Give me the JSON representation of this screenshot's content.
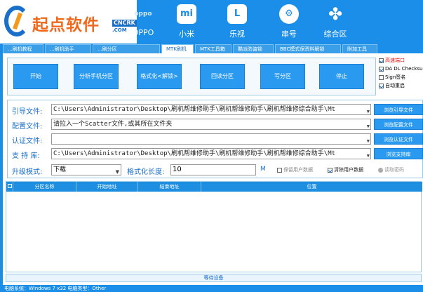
{
  "logo": {
    "name": "起点软件",
    "badge_top": "CNCRK",
    "badge_bottom": ".COM"
  },
  "nav": [
    {
      "label": "OPPO",
      "icon": "oppo-icon",
      "glyph": "oppo"
    },
    {
      "label": "小米",
      "icon": "mi-icon",
      "glyph": "mi"
    },
    {
      "label": "乐视",
      "icon": "letv-icon",
      "glyph": "L"
    },
    {
      "label": "串号",
      "icon": "gear-icon",
      "glyph": "⚙"
    },
    {
      "label": "综合区",
      "icon": "clover-icon",
      "glyph": "✤"
    }
  ],
  "subtabs": [
    "...刷机教程",
    "...刷机助手",
    "...刷分区",
    "MTK刷机",
    "MTK工具箱",
    "酷派防盗锁",
    "BBC模式保资料解锁",
    "附加工具"
  ],
  "actions": [
    "开始",
    "分析手机分区",
    "格式化<解锁>",
    "回读分区",
    "写分区",
    "停止"
  ],
  "options": [
    {
      "label": "高速端口",
      "checked": true,
      "red": true
    },
    {
      "label": "DA DL Checksum",
      "checked": true,
      "red": false
    },
    {
      "label": "Sign签名",
      "checked": false,
      "red": false
    },
    {
      "label": "自动重启",
      "checked": true,
      "red": false
    }
  ],
  "files": [
    {
      "label": "引导文件:",
      "value": "C:\\Users\\Administrator\\Desktop\\刷机帮维修助手\\刷机帮维修助手\\刷机帮维修综合助手\\Mt",
      "button": "浏览引导文件"
    },
    {
      "label": "配置文件:",
      "value": "请拉入一个Scatter文件,或其所在文件夹",
      "button": "浏览配置文件"
    },
    {
      "label": "认证文件:",
      "value": "",
      "button": "浏览认证文件"
    },
    {
      "label": "支 持 库:",
      "value": "C:\\Users\\Administrator\\Desktop\\刷机帮维修助手\\刷机帮维修助手\\刷机帮维修综合助手\\Mt",
      "button": "浏览支持库"
    }
  ],
  "upgrade": {
    "mode_label": "升级模式:",
    "mode_value": "下载",
    "length_label": "格式化长度:",
    "length_value": "10",
    "unit": "M",
    "keep_user": "保留用户数据",
    "keep_user_checked": false,
    "clear_user": "清除用户数据",
    "clear_user_checked": true,
    "read_password": "读取密码"
  },
  "table": {
    "headers": [
      "分区名称",
      "开始地址",
      "结束地址",
      "位置"
    ]
  },
  "status": "等待设备",
  "footer": "电脑系统：Windows 7 x32 电脑类型：Other"
}
